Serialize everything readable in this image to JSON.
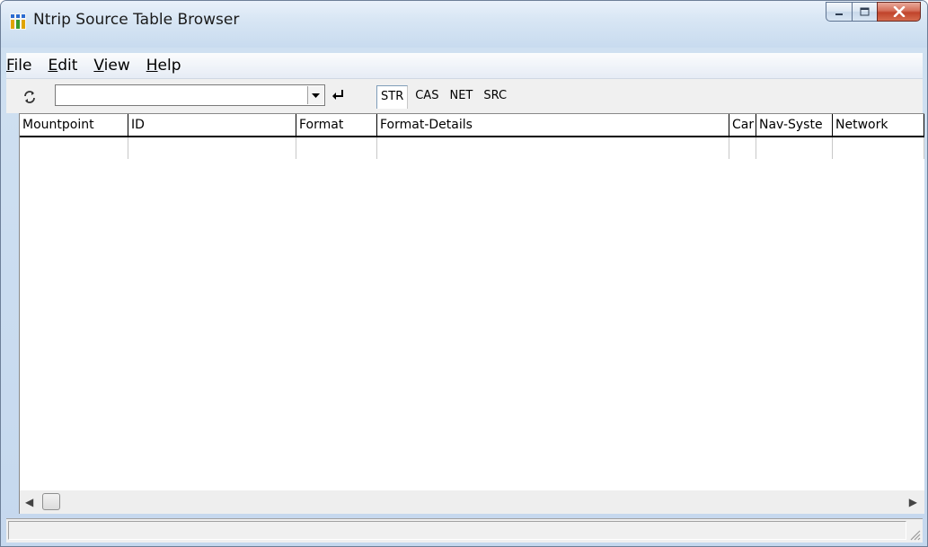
{
  "window": {
    "title": "Ntrip Source Table Browser",
    "icon": "ntrip-app-icon"
  },
  "menu": [
    "File",
    "Edit",
    "View",
    "Help"
  ],
  "toolbar": {
    "caster_value": "",
    "refresh_icon": "refresh-icon",
    "enter_icon": "enter-icon"
  },
  "tabs": [
    {
      "label": "STR",
      "active": true
    },
    {
      "label": "CAS",
      "active": false
    },
    {
      "label": "NET",
      "active": false
    },
    {
      "label": "SRC",
      "active": false
    }
  ],
  "table": {
    "columns": [
      "Mountpoint",
      "ID",
      "Format",
      "Format-Details",
      "Car",
      "Nav-Syste",
      "Network"
    ],
    "rows": []
  },
  "scrollbar": {
    "left_icon": "scroll-left-icon",
    "right_icon": "scroll-right-icon"
  },
  "status": {
    "text": ""
  }
}
